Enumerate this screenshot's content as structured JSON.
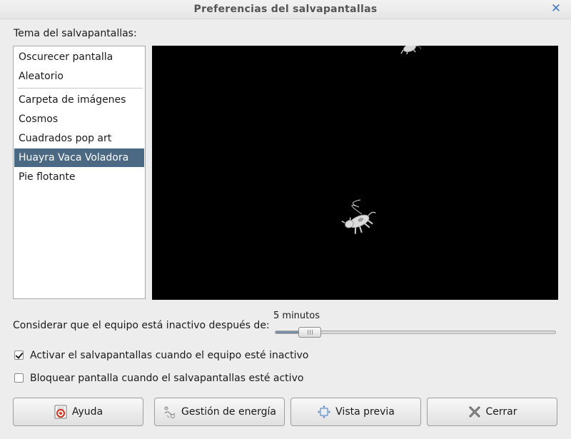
{
  "window": {
    "title": "Preferencias del salvapantallas",
    "close_icon": "close-icon"
  },
  "theme_section": {
    "label": "Tema del salvapantallas:",
    "items_top": [
      "Oscurecer pantalla",
      "Aleatorio"
    ],
    "items": [
      "Carpeta de imágenes",
      "Cosmos",
      "Cuadrados pop art",
      "Huayra Vaca Voladora",
      "Pie flotante"
    ],
    "selected": "Huayra Vaca Voladora",
    "selection_color": "#4b6983"
  },
  "idle": {
    "label": "Considerar que el equipo está inactivo después de:",
    "value_text": "5 minutos",
    "slider_fraction": 0.08
  },
  "checkboxes": [
    {
      "label": "Activar el salvapantallas cuando el equipo esté inactivo",
      "checked": true
    },
    {
      "label": "Bloquear pantalla cuando el salvapantallas esté activo",
      "checked": false
    }
  ],
  "buttons": {
    "help": {
      "label": "Ayuda",
      "icon": "help-icon"
    },
    "power": {
      "label": "Gestión de energía",
      "icon": "power-management-icon"
    },
    "preview": {
      "label": "Vista previa",
      "icon": "fullscreen-icon"
    },
    "close": {
      "label": "Cerrar",
      "icon": "close-x-icon"
    }
  }
}
